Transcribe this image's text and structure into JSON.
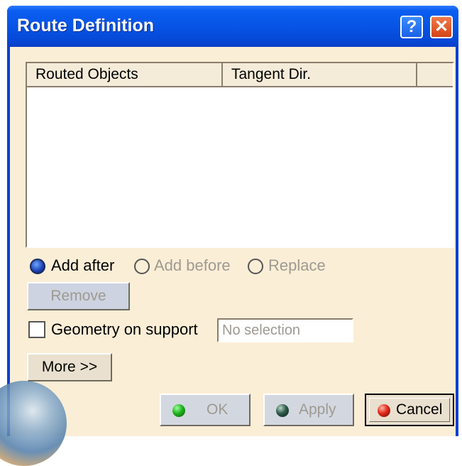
{
  "window": {
    "title": "Route Definition",
    "help_glyph": "?",
    "close_glyph": "✕"
  },
  "list": {
    "columns": [
      "Routed Objects",
      "Tangent Dir."
    ],
    "rows": []
  },
  "insert_mode": {
    "options": [
      {
        "label": "Add after",
        "selected": true,
        "enabled": true
      },
      {
        "label": "Add before",
        "selected": false,
        "enabled": false
      },
      {
        "label": "Replace",
        "selected": false,
        "enabled": false
      }
    ]
  },
  "remove_button": {
    "label": "Remove",
    "enabled": false
  },
  "geometry_on_support": {
    "label": "Geometry on support",
    "checked": false,
    "selection_text": "No selection"
  },
  "more_button": {
    "label": "More >>"
  },
  "buttons": {
    "ok": {
      "label": "OK",
      "enabled": false
    },
    "apply": {
      "label": "Apply",
      "enabled": false
    },
    "cancel": {
      "label": "Cancel",
      "enabled": true
    }
  },
  "colors": {
    "titlebar": "#0754e6",
    "client_bg": "#fbeed6",
    "disabled_text": "#9e9a92"
  },
  "icons": [
    "help-icon",
    "close-icon",
    "ok-status-icon",
    "apply-status-icon",
    "cancel-status-icon"
  ]
}
